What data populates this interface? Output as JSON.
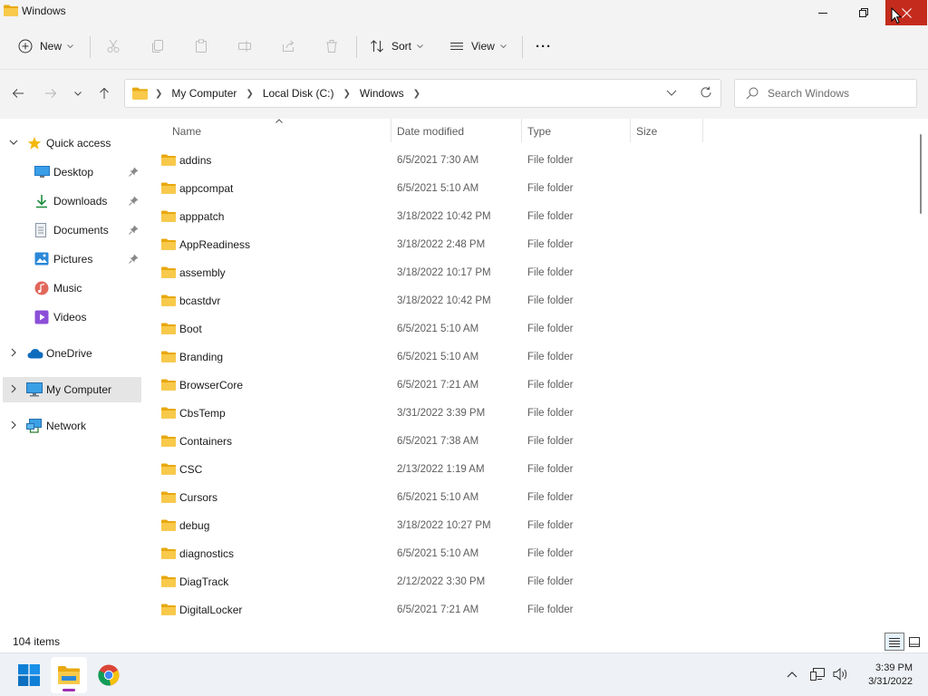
{
  "window": {
    "title": "Windows",
    "controls": [
      "minimize",
      "restore",
      "close"
    ]
  },
  "toolbar": {
    "new_label": "New",
    "sort_label": "Sort",
    "view_label": "View",
    "more_label": "···",
    "disabled_actions": [
      "cut",
      "copy",
      "paste",
      "rename",
      "share",
      "delete"
    ]
  },
  "address": {
    "breadcrumbs": [
      "My Computer",
      "Local Disk (C:)",
      "Windows"
    ],
    "search_placeholder": "Search Windows"
  },
  "nav": {
    "items": [
      {
        "label": "Quick access",
        "icon": "star-icon",
        "expanded": true
      },
      {
        "label": "Desktop",
        "icon": "desktop-icon",
        "pinned": true
      },
      {
        "label": "Downloads",
        "icon": "downloads-icon",
        "pinned": true
      },
      {
        "label": "Documents",
        "icon": "documents-icon",
        "pinned": true
      },
      {
        "label": "Pictures",
        "icon": "pictures-icon",
        "pinned": true
      },
      {
        "label": "Music",
        "icon": "music-icon"
      },
      {
        "label": "Videos",
        "icon": "videos-icon"
      },
      {
        "label": "OneDrive",
        "icon": "onedrive-icon",
        "expanded": false
      },
      {
        "label": "My Computer",
        "icon": "computer-icon",
        "expanded": false,
        "selected": true
      },
      {
        "label": "Network",
        "icon": "network-icon",
        "expanded": false
      }
    ]
  },
  "columns": {
    "name": "Name",
    "date": "Date modified",
    "type": "Type",
    "size": "Size"
  },
  "files": [
    {
      "name": "addins",
      "date": "6/5/2021 7:30 AM",
      "type": "File folder"
    },
    {
      "name": "appcompat",
      "date": "6/5/2021 5:10 AM",
      "type": "File folder"
    },
    {
      "name": "apppatch",
      "date": "3/18/2022 10:42 PM",
      "type": "File folder"
    },
    {
      "name": "AppReadiness",
      "date": "3/18/2022 2:48 PM",
      "type": "File folder"
    },
    {
      "name": "assembly",
      "date": "3/18/2022 10:17 PM",
      "type": "File folder"
    },
    {
      "name": "bcastdvr",
      "date": "3/18/2022 10:42 PM",
      "type": "File folder"
    },
    {
      "name": "Boot",
      "date": "6/5/2021 5:10 AM",
      "type": "File folder"
    },
    {
      "name": "Branding",
      "date": "6/5/2021 5:10 AM",
      "type": "File folder"
    },
    {
      "name": "BrowserCore",
      "date": "6/5/2021 7:21 AM",
      "type": "File folder"
    },
    {
      "name": "CbsTemp",
      "date": "3/31/2022 3:39 PM",
      "type": "File folder"
    },
    {
      "name": "Containers",
      "date": "6/5/2021 7:38 AM",
      "type": "File folder"
    },
    {
      "name": "CSC",
      "date": "2/13/2022 1:19 AM",
      "type": "File folder"
    },
    {
      "name": "Cursors",
      "date": "6/5/2021 5:10 AM",
      "type": "File folder"
    },
    {
      "name": "debug",
      "date": "3/18/2022 10:27 PM",
      "type": "File folder"
    },
    {
      "name": "diagnostics",
      "date": "6/5/2021 5:10 AM",
      "type": "File folder"
    },
    {
      "name": "DiagTrack",
      "date": "2/12/2022 3:30 PM",
      "type": "File folder"
    },
    {
      "name": "DigitalLocker",
      "date": "6/5/2021 7:21 AM",
      "type": "File folder"
    }
  ],
  "status": {
    "item_count": "104 items",
    "view_mode": "details"
  },
  "taskbar": {
    "apps": [
      "start-icon",
      "file-explorer-icon",
      "chrome-icon"
    ],
    "active_app": "file-explorer-icon",
    "time": "3:39 PM",
    "date": "3/31/2022"
  },
  "colors": {
    "close_button": "#c42b1c",
    "selected_nav": "#e5e5e5",
    "folder": "#f8c94a",
    "accent": "#0067c0"
  }
}
